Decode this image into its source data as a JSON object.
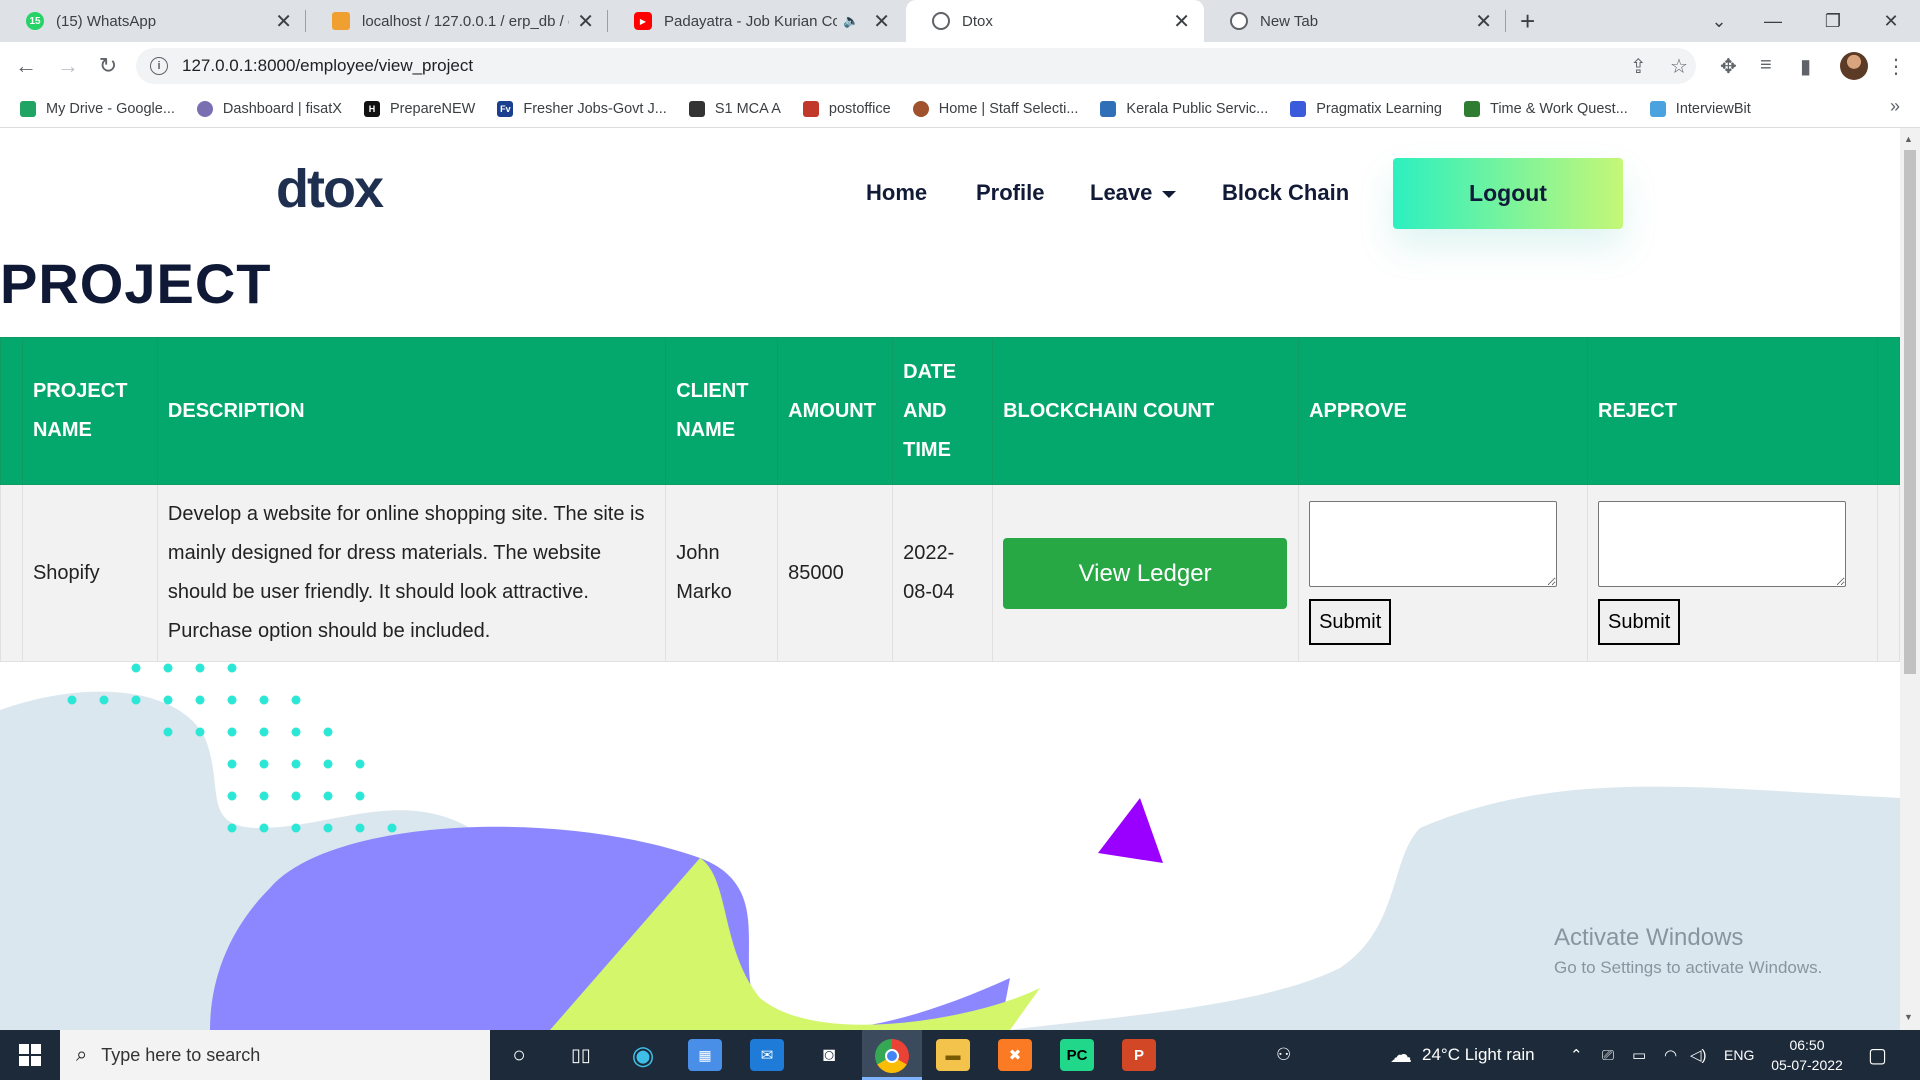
{
  "browser": {
    "tabs": [
      {
        "label": "(15) WhatsApp",
        "favicon_color": "#25d366",
        "favicon_text": "15",
        "active": false
      },
      {
        "label": "localhost / 127.0.0.1 / erp_db / er",
        "favicon_color": "#f0a030",
        "favicon_text": "",
        "active": false
      },
      {
        "label": "Padayatra - Job Kurian Collec",
        "favicon_color": "#ff0000",
        "favicon_text": "▶",
        "active": false
      },
      {
        "label": "Dtox",
        "favicon_color": "#5f6368",
        "favicon_text": "",
        "active": true
      },
      {
        "label": "New Tab",
        "favicon_color": "#5f6368",
        "favicon_text": "",
        "active": false
      }
    ],
    "url": "127.0.0.1:8000/employee/view_project",
    "bookmarks": [
      {
        "label": "My Drive - Google...",
        "color": "#1fa463"
      },
      {
        "label": "Dashboard | fisatX",
        "color": "#7a6fb0"
      },
      {
        "label": "PrepareNEW",
        "color": "#111111"
      },
      {
        "label": "Fresher Jobs-Govt J...",
        "color": "#1a3f8f"
      },
      {
        "label": "S1 MCA A",
        "color": "#333333"
      },
      {
        "label": "postoffice",
        "color": "#c0392b"
      },
      {
        "label": "Home | Staff Selecti...",
        "color": "#a0522d"
      },
      {
        "label": "Kerala Public Servic...",
        "color": "#2e6fb7"
      },
      {
        "label": "Pragmatix Learning",
        "color": "#3b5bdb"
      },
      {
        "label": "Time & Work Quest...",
        "color": "#2f7d32"
      },
      {
        "label": "InterviewBit",
        "color": "#4aa3df"
      }
    ]
  },
  "site": {
    "logo": "dtox",
    "nav": {
      "home": "Home",
      "profile": "Profile",
      "leave": "Leave",
      "blockchain": "Block Chain",
      "logout": "Logout"
    },
    "page_title": "PROJECT"
  },
  "table": {
    "headers": {
      "project_name": "PROJECT NAME",
      "description": "DESCRIPTION",
      "client_name": "CLIENT NAME",
      "amount": "AMOUNT",
      "date_time": "DATE AND TIME",
      "blockchain_count": "BLOCKCHAIN COUNT",
      "approve": "APPROVE",
      "reject": "REJECT"
    },
    "rows": [
      {
        "project_name": "Shopify",
        "description": "Develop a website for online shopping site. The site is mainly designed for dress materials. The website should be user friendly. It should look attractive. Purchase option should be included.",
        "client_name": "John Marko",
        "amount": "85000",
        "date_time": "2022-08-04",
        "view_ledger": "View Ledger",
        "approve_submit": "Submit",
        "reject_submit": "Submit"
      }
    ]
  },
  "watermark": {
    "line1": "Activate Windows",
    "line2": "Go to Settings to activate Windows."
  },
  "taskbar": {
    "search_placeholder": "Type here to search",
    "weather": "24°C  Light rain",
    "language": "ENG",
    "time": "06:50",
    "date": "05-07-2022"
  },
  "colors": {
    "header_green": "#04a86c",
    "ledger_green": "#28a745",
    "logout_gradient": [
      "#2cf0c0",
      "#c5f777"
    ],
    "dark_navy": "#0f1936",
    "taskbar": "#1c2a3a"
  }
}
